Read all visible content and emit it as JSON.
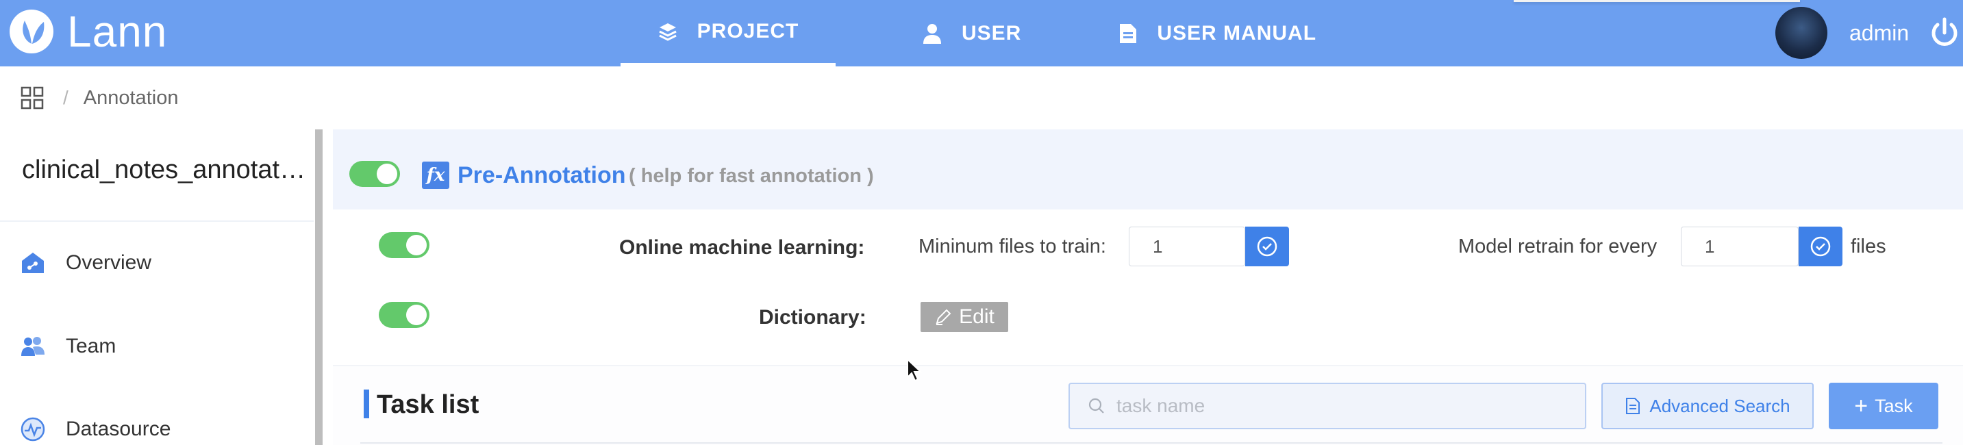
{
  "app": {
    "name": "Lann"
  },
  "nav": {
    "items": [
      {
        "label": "PROJECT",
        "active": true,
        "icon": "layers-icon"
      },
      {
        "label": "USER",
        "active": false,
        "icon": "user-icon"
      },
      {
        "label": "USER MANUAL",
        "active": false,
        "icon": "document-icon"
      }
    ]
  },
  "user": {
    "name": "admin"
  },
  "breadcrumb": {
    "separator": "/",
    "current": "Annotation"
  },
  "sidebar": {
    "project_name": "clinical_notes_annotation",
    "items": [
      {
        "label": "Overview",
        "icon": "overview-icon"
      },
      {
        "label": "Team",
        "icon": "team-icon"
      },
      {
        "label": "Datasource",
        "icon": "datasource-icon"
      }
    ]
  },
  "pre_annotation": {
    "enabled": true,
    "icon_text": "fx",
    "title": "Pre-Annotation",
    "help": "( help for fast annotation )"
  },
  "online_ml": {
    "enabled": true,
    "label": "Online machine learning:",
    "min_files_label": "Mininum files to train:",
    "min_files_value": "1",
    "retrain_label": "Model retrain for every",
    "retrain_value": "1",
    "retrain_suffix": "files"
  },
  "dictionary": {
    "enabled": true,
    "label": "Dictionary:",
    "edit_label": "Edit"
  },
  "task_list": {
    "title": "Task list",
    "search_placeholder": "task name",
    "advanced_search_label": "Advanced Search",
    "add_task_label": "Task"
  },
  "colors": {
    "header": "#6c9ff0",
    "accent": "#3f81e8",
    "toggle_on": "#63c96b"
  }
}
